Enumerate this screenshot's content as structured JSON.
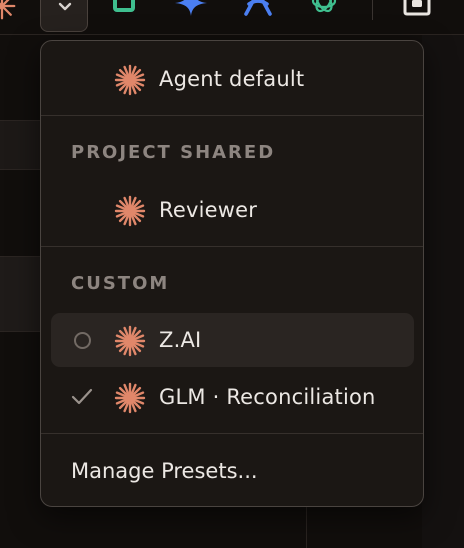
{
  "toolbar": {
    "icons": [
      "claude-spark-icon",
      "chevron-down-icon",
      "green-square-icon",
      "four-point-star-icon",
      "ai-logo-icon",
      "openai-icon",
      "share-icon"
    ],
    "colors": {
      "spark": "#e0876a",
      "green": "#3fbf8f",
      "blue": "#4b7ff2"
    }
  },
  "menu": {
    "default_item": {
      "label": "Agent default",
      "icon": "claude-spark-icon"
    },
    "project_shared": {
      "heading": "PROJECT SHARED",
      "items": [
        {
          "label": "Reviewer",
          "icon": "claude-spark-icon"
        }
      ]
    },
    "custom": {
      "heading": "CUSTOM",
      "items": [
        {
          "label": "Z.AI",
          "icon": "claude-spark-icon",
          "state": "unselected-radio"
        },
        {
          "label": "GLM · Reconciliation",
          "icon": "claude-spark-icon",
          "state": "checked"
        }
      ]
    },
    "manage_label": "Manage Presets..."
  }
}
